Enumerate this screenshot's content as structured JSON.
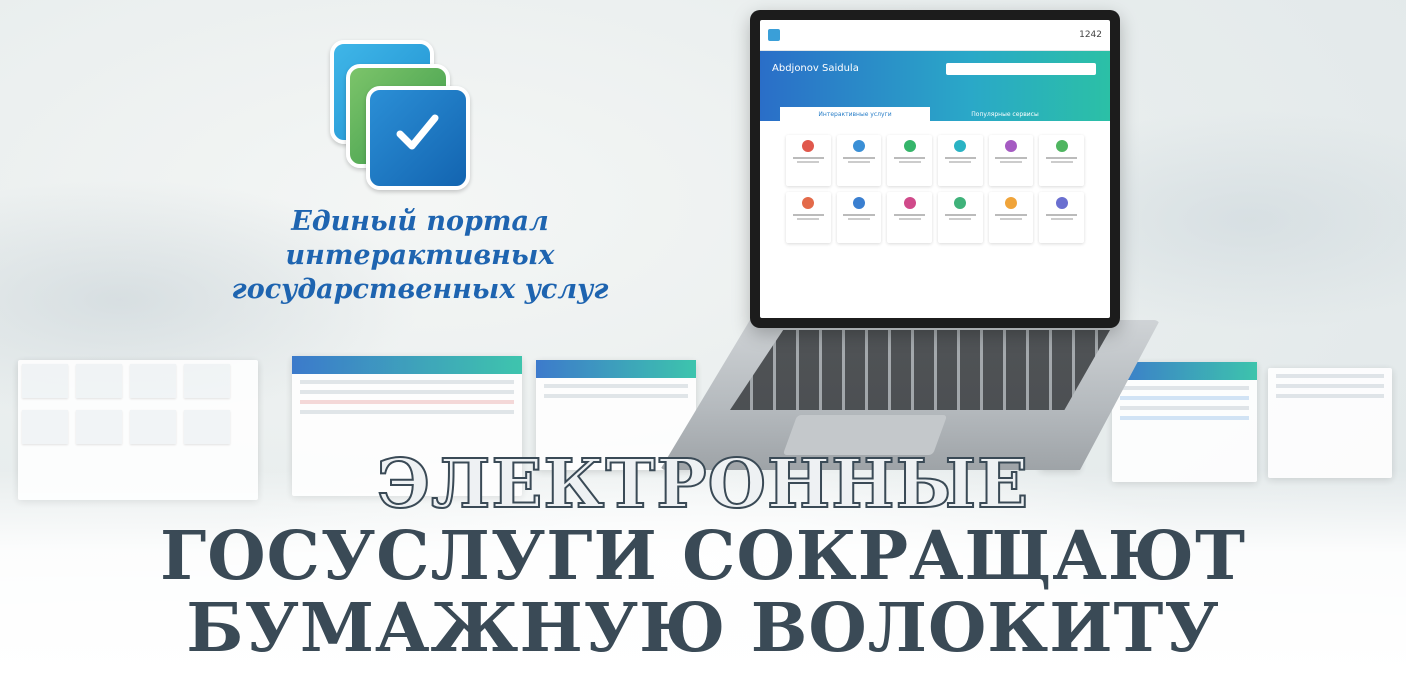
{
  "tagline": {
    "line1": "Единый портал",
    "line2": "интерактивных",
    "line3": "государственных услуг"
  },
  "headline": {
    "line1": "ЭЛЕКТРОННЫЕ",
    "line2": "ГОСУСЛУГИ СОКРАЩАЮТ",
    "line3": "БУМАЖНУЮ ВОЛОКИТУ"
  },
  "screen": {
    "user_name": "Abdjonov Saidula",
    "counter": "1242",
    "tab_active": "Интерактивные услуги",
    "tab_other": "Популярные сервисы"
  },
  "colors": {
    "brand_blue": "#1e64b0",
    "headline_dark": "#3a4a56",
    "logo_blue": "#2b8fd6",
    "logo_green": "#3c9a4a",
    "logo_light_blue": "#3fb6e8"
  }
}
